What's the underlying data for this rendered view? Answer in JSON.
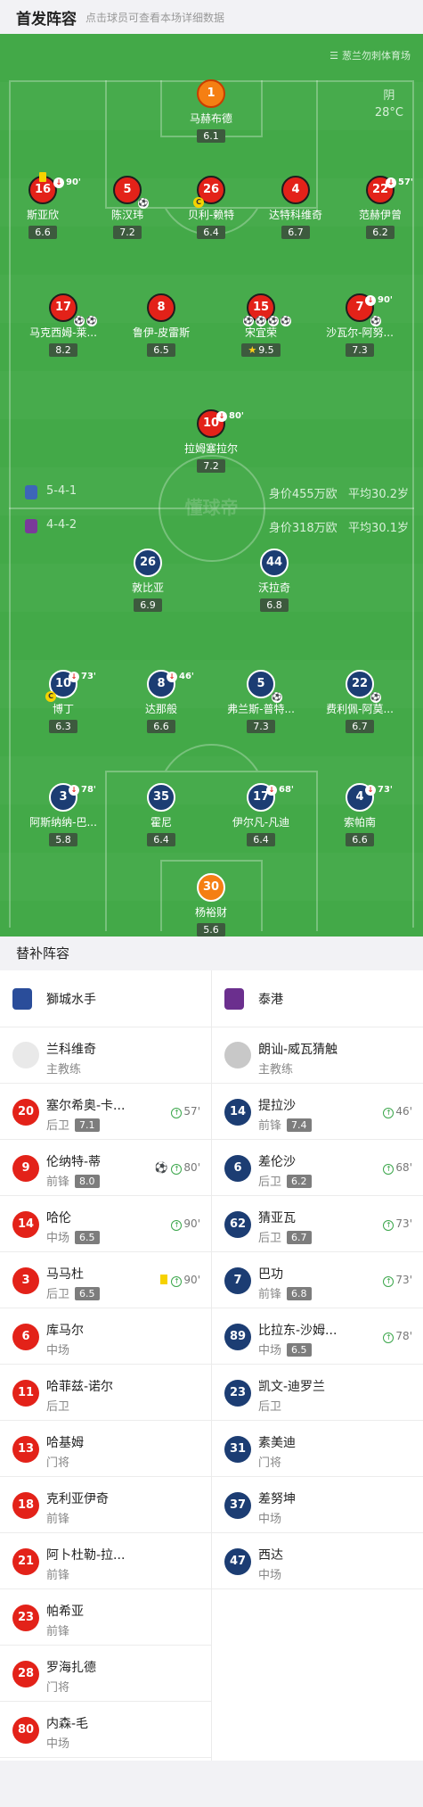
{
  "header": {
    "title": "首发阵容",
    "hint": "点击球员可查看本场详细数据"
  },
  "venue": {
    "name": "葱兰勿刺体育场"
  },
  "weather": {
    "cond": "阴",
    "temp": "28°C"
  },
  "watermark": "懂球帝",
  "home_team": {
    "formation": "5-4-1",
    "value": "身价455万欧",
    "avg_age": "平均30.2岁",
    "color": "#e32219"
  },
  "away_team": {
    "formation": "4-4-2",
    "value": "身价318万欧",
    "avg_age": "平均30.1岁",
    "color": "#1c3d73"
  },
  "home_players": [
    {
      "num": "1",
      "name": "马赫布德",
      "rating": "6.1"
    },
    {
      "num": "16",
      "name": "斯亚欣",
      "rating": "6.6",
      "sub_min": "90'"
    },
    {
      "num": "5",
      "name": "陈汉玮",
      "rating": "7.2"
    },
    {
      "num": "26",
      "name": "贝利-赖特",
      "rating": "6.4"
    },
    {
      "num": "4",
      "name": "达特科维奇",
      "rating": "6.7"
    },
    {
      "num": "22",
      "name": "范赫伊曾",
      "rating": "6.2",
      "sub_min": "57'"
    },
    {
      "num": "17",
      "name": "马克西姆-莱...",
      "rating": "8.2"
    },
    {
      "num": "8",
      "name": "鲁伊-皮雷斯",
      "rating": "6.5"
    },
    {
      "num": "15",
      "name": "宋宜荣",
      "rating": "9.5"
    },
    {
      "num": "7",
      "name": "沙瓦尔-阿努...",
      "rating": "7.3",
      "sub_min": "90'"
    },
    {
      "num": "10",
      "name": "拉姆塞拉尔",
      "rating": "7.2",
      "sub_min": "80'"
    }
  ],
  "away_players": [
    {
      "num": "26",
      "name": "敦比亚",
      "rating": "6.9"
    },
    {
      "num": "44",
      "name": "沃拉奇",
      "rating": "6.8"
    },
    {
      "num": "10",
      "name": "博丁",
      "rating": "6.3",
      "sub_min": "73'"
    },
    {
      "num": "8",
      "name": "达那般",
      "rating": "6.6",
      "sub_min": "46'"
    },
    {
      "num": "5",
      "name": "弗兰斯-普特...",
      "rating": "7.3"
    },
    {
      "num": "22",
      "name": "费利佩-阿莫...",
      "rating": "6.7"
    },
    {
      "num": "3",
      "name": "阿斯纳纳-巴...",
      "rating": "5.8",
      "sub_min": "78'"
    },
    {
      "num": "35",
      "name": "霍尼",
      "rating": "6.4"
    },
    {
      "num": "17",
      "name": "伊尔凡-凡迪",
      "rating": "6.4",
      "sub_min": "68'"
    },
    {
      "num": "4",
      "name": "索帕南",
      "rating": "6.6",
      "sub_min": "73'"
    },
    {
      "num": "30",
      "name": "杨裕财",
      "rating": "5.6"
    }
  ],
  "bench_title": "替补阵容",
  "home_bench": {
    "team": "獅城水手",
    "coach": {
      "name": "兰科维奇",
      "role": "主教练"
    },
    "players": [
      {
        "num": "20",
        "name": "塞尔希奥-卡...",
        "pos": "后卫",
        "rating": "7.1",
        "event": "57'"
      },
      {
        "num": "9",
        "name": "伦纳特-蒂",
        "pos": "前锋",
        "rating": "8.0",
        "event": "80'"
      },
      {
        "num": "14",
        "name": "哈伦",
        "pos": "中场",
        "rating": "6.5",
        "event": "90'"
      },
      {
        "num": "3",
        "name": "马马杜",
        "pos": "后卫",
        "rating": "6.5",
        "event": "90'"
      },
      {
        "num": "6",
        "name": "库马尔",
        "pos": "中场"
      },
      {
        "num": "11",
        "name": "哈菲兹-诺尔",
        "pos": "后卫"
      },
      {
        "num": "13",
        "name": "哈基姆",
        "pos": "门将"
      },
      {
        "num": "18",
        "name": "克利亚伊奇",
        "pos": "前锋"
      },
      {
        "num": "21",
        "name": "阿卜杜勒-拉...",
        "pos": "前锋"
      },
      {
        "num": "23",
        "name": "帕希亚",
        "pos": "前锋"
      },
      {
        "num": "28",
        "name": "罗海扎德",
        "pos": "门将"
      },
      {
        "num": "80",
        "name": "内森-毛",
        "pos": "中场"
      }
    ]
  },
  "away_bench": {
    "team": "泰港",
    "coach": {
      "name": "朗讪-威瓦猜触",
      "role": "主教练"
    },
    "players": [
      {
        "num": "14",
        "name": "提拉沙",
        "pos": "前锋",
        "rating": "7.4",
        "event": "46'"
      },
      {
        "num": "6",
        "name": "差伦沙",
        "pos": "后卫",
        "rating": "6.2",
        "event": "68'"
      },
      {
        "num": "62",
        "name": "猜亚瓦",
        "pos": "后卫",
        "rating": "6.7",
        "event": "73'"
      },
      {
        "num": "7",
        "name": "巴功",
        "pos": "前锋",
        "rating": "6.8",
        "event": "73'"
      },
      {
        "num": "89",
        "name": "比拉东-沙姆...",
        "pos": "中场",
        "rating": "6.5",
        "event": "78'"
      },
      {
        "num": "23",
        "name": "凯文-迪罗兰",
        "pos": "后卫"
      },
      {
        "num": "31",
        "name": "素美迪",
        "pos": "门将"
      },
      {
        "num": "37",
        "name": "差努坤",
        "pos": "中场"
      },
      {
        "num": "47",
        "name": "西达",
        "pos": "中场"
      }
    ]
  }
}
